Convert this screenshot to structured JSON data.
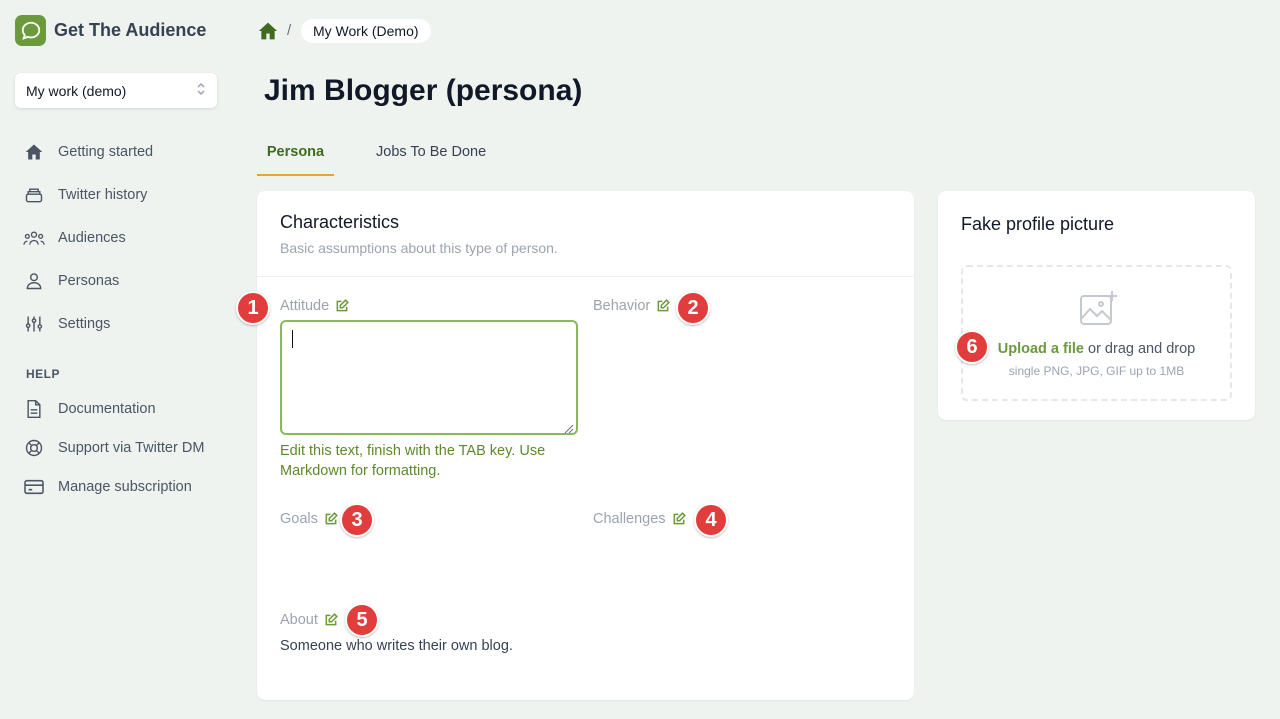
{
  "app": {
    "name": "Get The Audience"
  },
  "workspace": {
    "selected": "My work (demo)"
  },
  "sidebar": {
    "items": [
      {
        "label": "Getting started",
        "icon": "home-icon"
      },
      {
        "label": "Twitter history",
        "icon": "archive-icon"
      },
      {
        "label": "Audiences",
        "icon": "users-icon"
      },
      {
        "label": "Personas",
        "icon": "user-icon"
      },
      {
        "label": "Settings",
        "icon": "sliders-icon"
      }
    ],
    "help_label": "HELP",
    "help_items": [
      {
        "label": "Documentation",
        "icon": "document-icon"
      },
      {
        "label": "Support via Twitter DM",
        "icon": "lifebuoy-icon"
      },
      {
        "label": "Manage subscription",
        "icon": "credit-card-icon"
      }
    ]
  },
  "breadcrumb": {
    "separator": "/",
    "current": "My Work (Demo)"
  },
  "page": {
    "title": "Jim Blogger (persona)"
  },
  "tabs": [
    {
      "label": "Persona",
      "active": true
    },
    {
      "label": "Jobs To Be Done",
      "active": false
    }
  ],
  "characteristics": {
    "title": "Characteristics",
    "subtitle": "Basic assumptions about this type of person.",
    "fields": {
      "attitude": {
        "label": "Attitude",
        "value": "",
        "hint": "Edit this text, finish with the TAB key. Use Markdown for formatting."
      },
      "behavior": {
        "label": "Behavior"
      },
      "goals": {
        "label": "Goals"
      },
      "challenges": {
        "label": "Challenges"
      },
      "about": {
        "label": "About",
        "value": "Someone who writes their own blog."
      }
    }
  },
  "badges": [
    "1",
    "2",
    "3",
    "4",
    "5",
    "6"
  ],
  "profile_picture": {
    "title": "Fake profile picture",
    "upload_link": "Upload a file",
    "upload_rest": " or drag and drop",
    "constraints": "single PNG, JPG, GIF up to 1MB"
  },
  "colors": {
    "accent": "#6b9a3c",
    "badge": "#e23d3d",
    "tab_underline": "#e8a236",
    "background": "#eef3f0"
  }
}
